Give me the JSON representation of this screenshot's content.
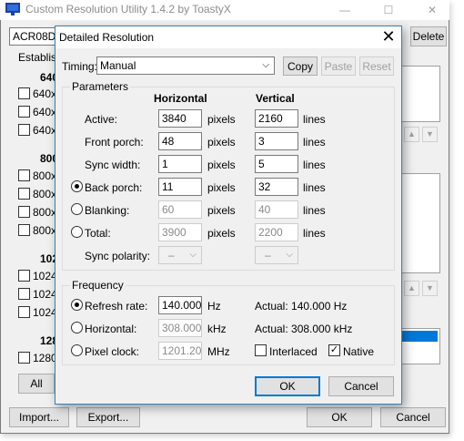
{
  "main_window": {
    "title": "Custom Resolution Utility 1.4.2 by ToastyX",
    "controls": {
      "minimize": "—",
      "maximize": "☐",
      "close": "✕"
    },
    "monitor_combo": "ACR08DE",
    "delete_label": "Delete",
    "established_label": "Establis",
    "sections": [
      {
        "header": "640",
        "items": [
          "640x",
          "640x",
          "640x"
        ]
      },
      {
        "header": "800",
        "items": [
          "800x",
          "800x",
          "800x",
          "800x"
        ]
      },
      {
        "header": "102",
        "items": [
          "1024",
          "1024",
          "1024"
        ]
      },
      {
        "header": "128",
        "items": [
          "1280"
        ]
      }
    ],
    "all_label": "All",
    "import_label": "Import...",
    "export_label": "Export...",
    "ok_label": "OK",
    "cancel_label": "Cancel"
  },
  "dialog": {
    "title": "Detailed Resolution",
    "close": "✕",
    "timing_label": "Timing:",
    "timing_value": "Manual",
    "copy_label": "Copy",
    "paste_label": "Paste",
    "reset_label": "Reset",
    "parameters": {
      "group_label": "Parameters",
      "horizontal_header": "Horizontal",
      "vertical_header": "Vertical",
      "rows": [
        {
          "label": "Active:",
          "h": "3840",
          "h_unit": "pixels",
          "v": "2160",
          "v_unit": "lines"
        },
        {
          "label": "Front porch:",
          "h": "48",
          "h_unit": "pixels",
          "v": "3",
          "v_unit": "lines"
        },
        {
          "label": "Sync width:",
          "h": "1",
          "h_unit": "pixels",
          "v": "5",
          "v_unit": "lines"
        },
        {
          "label": "Back porch:",
          "h": "11",
          "h_unit": "pixels",
          "v": "32",
          "v_unit": "lines"
        },
        {
          "label": "Blanking:",
          "h": "60",
          "h_unit": "pixels",
          "v": "40",
          "v_unit": "lines"
        },
        {
          "label": "Total:",
          "h": "3900",
          "h_unit": "pixels",
          "v": "2200",
          "v_unit": "lines"
        }
      ],
      "sync_polarity_label": "Sync polarity:",
      "h_polarity": "–",
      "v_polarity": "–"
    },
    "frequency": {
      "group_label": "Frequency",
      "refresh_label": "Refresh rate:",
      "refresh_value": "140.000",
      "refresh_unit": "Hz",
      "refresh_actual": "Actual: 140.000 Hz",
      "horizontal_label": "Horizontal:",
      "horizontal_value": "308.000",
      "horizontal_unit": "kHz",
      "horizontal_actual": "Actual: 308.000 kHz",
      "pixel_clock_label": "Pixel clock:",
      "pixel_clock_value": "1201.20",
      "pixel_clock_unit": "MHz",
      "interlaced_label": "Interlaced",
      "native_label": "Native"
    },
    "ok_label": "OK",
    "cancel_label": "Cancel"
  },
  "colors": {
    "accent": "#0078d7",
    "selection": "#0078d7"
  }
}
